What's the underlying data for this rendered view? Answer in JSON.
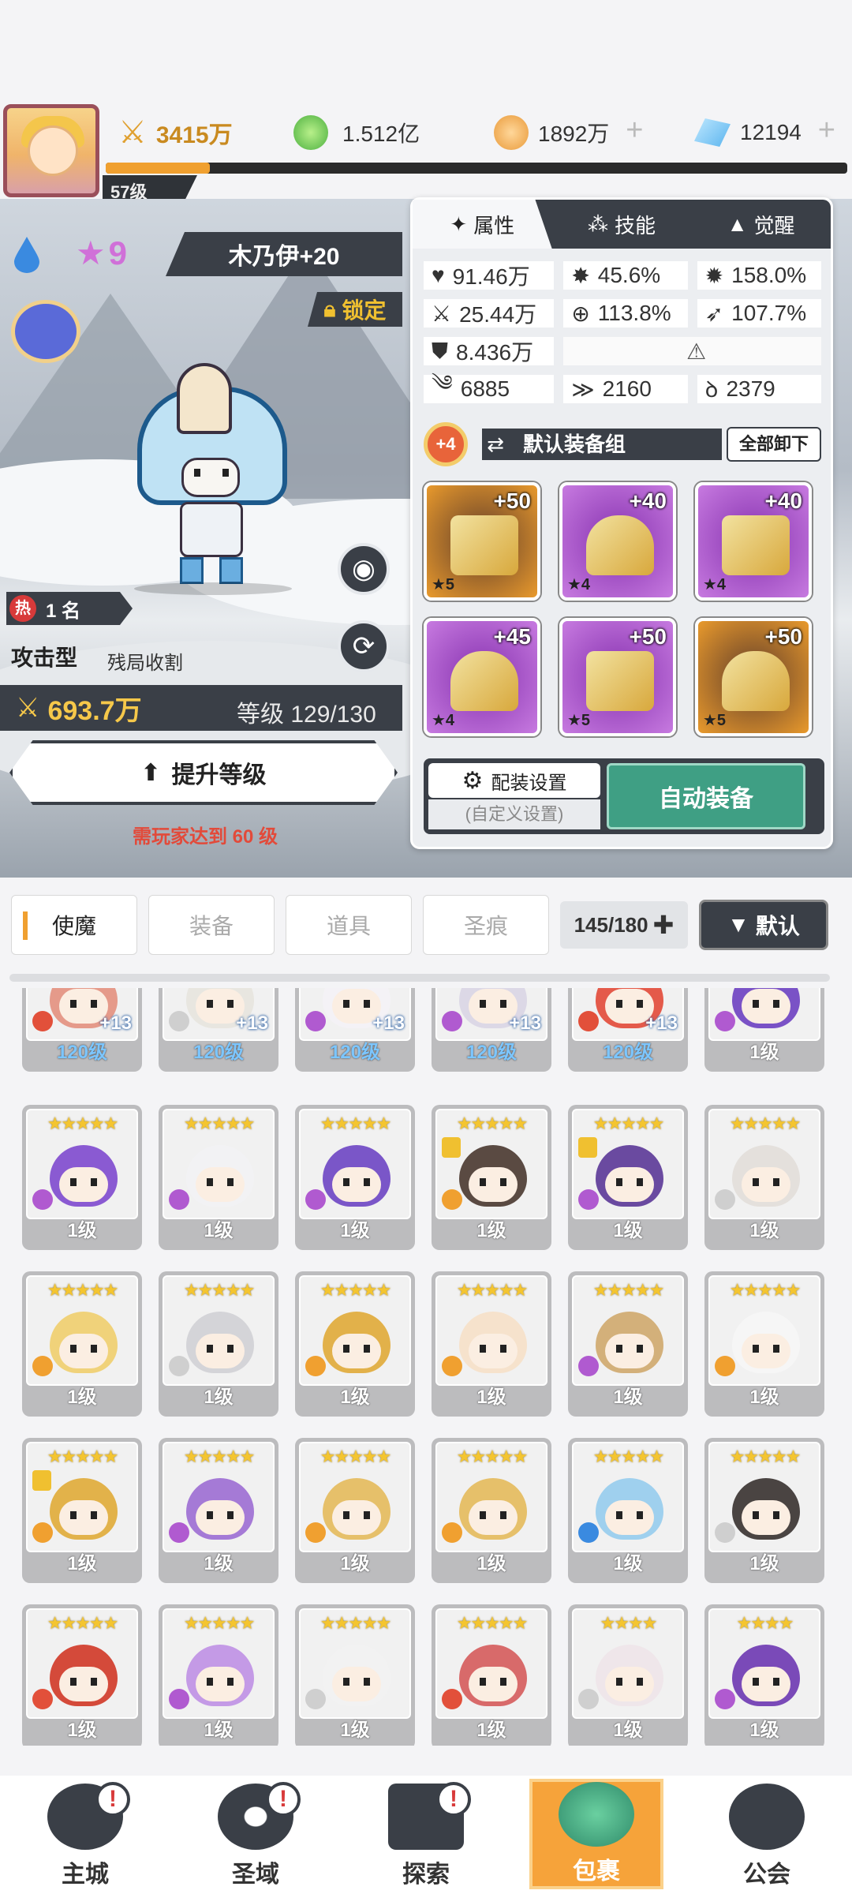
{
  "header": {
    "player_level": "57级",
    "combat_power": "3415万",
    "green_gems": "1.512亿",
    "gold_coins": "1892万",
    "crystals": "12194",
    "player_xp_fraction": 0.14
  },
  "hero": {
    "name": "木乃伊+20",
    "star": "9",
    "lock_label": "锁定",
    "rank_badge": "热",
    "rank": "1 名",
    "type": "攻击型",
    "skill": "残局收割",
    "power": "693.7万",
    "level": "等级 129/130",
    "upgrade_label": "提升等级",
    "requirement": "需玩家达到 60 级"
  },
  "panel": {
    "tabs": [
      "属性",
      "技能",
      "觉醒"
    ],
    "stats": [
      [
        "91.46万",
        "45.6%",
        "158.0%"
      ],
      [
        "25.44万",
        "113.8%",
        "107.7%"
      ],
      [
        "8.436万"
      ],
      [
        "6885",
        "2160",
        "2379"
      ]
    ],
    "refine_bonus": "+4",
    "equip_set": "默认装备组",
    "unequip_all": "全部卸下",
    "gear": [
      {
        "plus": "+50",
        "stars": "★5",
        "rarity": "orange"
      },
      {
        "plus": "+40",
        "stars": "★4",
        "rarity": "purple"
      },
      {
        "plus": "+40",
        "stars": "★4",
        "rarity": "purple"
      },
      {
        "plus": "+45",
        "stars": "★4",
        "rarity": "purple"
      },
      {
        "plus": "+50",
        "stars": "★5",
        "rarity": "purple"
      },
      {
        "plus": "+50",
        "stars": "★5",
        "rarity": "orange"
      }
    ],
    "config_label": "配装设置",
    "config_sub": "(自定义设置)",
    "auto_label": "自动装备"
  },
  "inventory": {
    "tabs": [
      "使魔",
      "装备",
      "道具",
      "圣痕"
    ],
    "capacity": "145/180",
    "sort": "默认"
  },
  "cards": [
    {
      "lv": "120级",
      "plus": "+13",
      "locked": true,
      "blue": true,
      "elem": "#e2503a",
      "hair": "#e59a8a"
    },
    {
      "lv": "120级",
      "plus": "+13",
      "locked": false,
      "blue": true,
      "elem": "#cfcfcf",
      "hair": "#e8e6e0"
    },
    {
      "lv": "120级",
      "plus": "+13",
      "locked": true,
      "blue": true,
      "elem": "#b05ad0",
      "hair": "#f4f2f6"
    },
    {
      "lv": "120级",
      "plus": "+13",
      "locked": false,
      "blue": true,
      "elem": "#b05ad0",
      "hair": "#dcd8e6"
    },
    {
      "lv": "120级",
      "plus": "+13",
      "locked": true,
      "blue": true,
      "elem": "#e2503a",
      "hair": "#e45a4a"
    },
    {
      "lv": "1级",
      "plus": "",
      "locked": false,
      "blue": false,
      "elem": "#b05ad0",
      "hair": "#7a52c6"
    },
    {
      "lv": "1级",
      "stars": "★★★★★",
      "elem": "#b05ad0",
      "hair": "#8a5ad2",
      "locked": false
    },
    {
      "lv": "1级",
      "stars": "★★★★★",
      "elem": "#b05ad0",
      "hair": "#f2f2f4",
      "locked": false
    },
    {
      "lv": "1级",
      "stars": "★★★★★",
      "elem": "#b05ad0",
      "hair": "#7a56c8",
      "locked": false
    },
    {
      "lv": "1级",
      "stars": "★★★★★",
      "elem": "#f0a030",
      "hair": "#5a4a42",
      "locked": true
    },
    {
      "lv": "1级",
      "stars": "★★★★★",
      "elem": "#b05ad0",
      "hair": "#6a4aa0",
      "locked": true
    },
    {
      "lv": "1级",
      "stars": "★★★★★",
      "elem": "#cfcfcf",
      "hair": "#e4e0dc",
      "locked": false
    },
    {
      "lv": "1级",
      "stars": "★★★★★",
      "elem": "#f0a030",
      "hair": "#f0d27a",
      "locked": false
    },
    {
      "lv": "1级",
      "stars": "★★★★★",
      "elem": "#cfcfcf",
      "hair": "#d4d4d8",
      "locked": false
    },
    {
      "lv": "1级",
      "stars": "★★★★★",
      "elem": "#f0a030",
      "hair": "#e2b14a",
      "locked": false
    },
    {
      "lv": "1级",
      "stars": "★★★★★",
      "elem": "#f0a030",
      "hair": "#f6e2cc",
      "locked": false
    },
    {
      "lv": "1级",
      "stars": "★★★★★",
      "elem": "#b05ad0",
      "hair": "#d3b07a",
      "locked": false
    },
    {
      "lv": "1级",
      "stars": "★★★★★",
      "elem": "#f0a030",
      "hair": "#f6f6f6",
      "locked": false
    },
    {
      "lv": "1级",
      "stars": "★★★★★",
      "elem": "#f0a030",
      "hair": "#e2b24a",
      "locked": true
    },
    {
      "lv": "1级",
      "stars": "★★★★★",
      "elem": "#b05ad0",
      "hair": "#a57ad6",
      "locked": false
    },
    {
      "lv": "1级",
      "stars": "★★★★★",
      "elem": "#f0a030",
      "hair": "#e6c06a",
      "locked": false
    },
    {
      "lv": "1级",
      "stars": "★★★★★",
      "elem": "#f0a030",
      "hair": "#e6c06a",
      "locked": false
    },
    {
      "lv": "1级",
      "stars": "★★★★★",
      "elem": "#3a8ae0",
      "hair": "#9fd0ee",
      "locked": false
    },
    {
      "lv": "1级",
      "stars": "★★★★★",
      "elem": "#cfcfcf",
      "hair": "#4a4442",
      "locked": false
    },
    {
      "lv": "1级",
      "stars": "★★★★★",
      "elem": "#e2503a",
      "hair": "#d44a3a",
      "locked": false
    },
    {
      "lv": "1级",
      "stars": "★★★★★",
      "elem": "#b05ad0",
      "hair": "#c49ae6",
      "locked": false
    },
    {
      "lv": "1级",
      "stars": "★★★★★",
      "elem": "#cfcfcf",
      "hair": "#f2f2f2",
      "locked": false
    },
    {
      "lv": "1级",
      "stars": "★★★★★",
      "elem": "#e2503a",
      "hair": "#d86a6a",
      "locked": false
    },
    {
      "lv": "1级",
      "stars": "★★★★",
      "elem": "#cfcfcf",
      "hair": "#efe6ea",
      "locked": false
    },
    {
      "lv": "1级",
      "stars": "★★★★",
      "elem": "#b05ad0",
      "hair": "#7a4ab8",
      "locked": false
    }
  ],
  "nav": [
    {
      "label": "主城",
      "badge": "!"
    },
    {
      "label": "圣域",
      "badge": "!"
    },
    {
      "label": "探索",
      "badge": "!"
    },
    {
      "label": "包裹",
      "badge": ""
    },
    {
      "label": "公会",
      "badge": ""
    }
  ]
}
